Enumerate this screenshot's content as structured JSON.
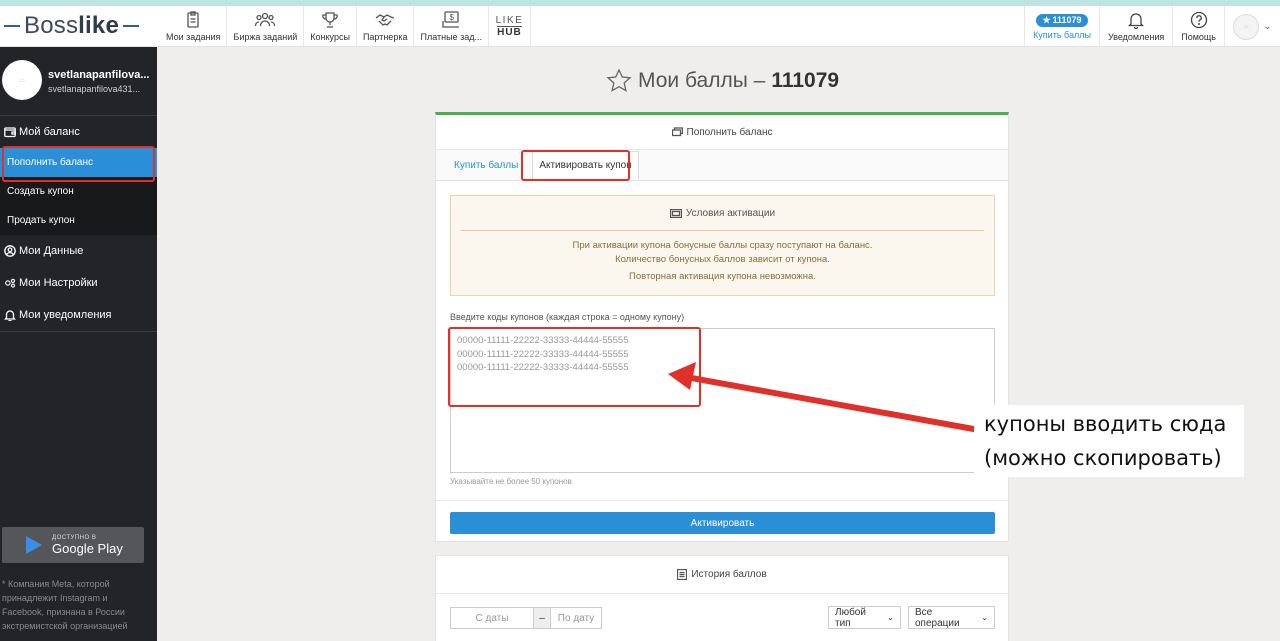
{
  "header": {
    "logo_prefix": "Boss",
    "logo_bold": "like",
    "nav": [
      {
        "label": "Мои задания",
        "icon": "clipboard-icon"
      },
      {
        "label": "Биржа заданий",
        "icon": "users-icon"
      },
      {
        "label": "Конкурсы",
        "icon": "trophy-icon"
      },
      {
        "label": "Партнерка",
        "icon": "handshake-icon"
      },
      {
        "label": "Платные зад...",
        "icon": "paid-tasks-icon"
      }
    ],
    "likehub_top": "LIKE",
    "likehub_bottom": "HUB",
    "points_badge": "111079",
    "buy_points_label": "Купить баллы",
    "notifications_label": "Уведомления",
    "help_label": "Помощь"
  },
  "sidebar": {
    "username": "svetlanapanfilova...",
    "email": "svetlanapanfilova431...",
    "balance_group": "Мой баланс",
    "balance_items": [
      "Пополнить баланс",
      "Создать купон",
      "Продать купон"
    ],
    "my_data": "Мои Данные",
    "my_settings": "Мои Настройки",
    "my_notifications": "Мои уведомления",
    "gplay_small": "ДОСТУПНО В",
    "gplay_big": "Google Play",
    "meta_note": "* Компания Meta, которой принадлежит Instagram и Facebook, признана в России экстремистской организацией"
  },
  "main": {
    "title_prefix": "Мои баллы –",
    "title_points": "111079",
    "card_title": "Пополнить баланс",
    "tab_buy": "Купить баллы",
    "tab_activate": "Активировать купон",
    "cond_title": "Условия активации",
    "cond_line1": "При активации купона бонусные баллы сразу поступают на баланс.",
    "cond_line2": "Количество бонусных баллов зависит от купона.",
    "cond_line3": "Повторная активация купона невозможна.",
    "codes_label": "Введите коды купонов (каждая строка = одному купону)",
    "codes_placeholder": "00000-11111-22222-33333-44444-55555\n00000-11111-22222-33333-44444-55555\n00000-11111-22222-33333-44444-55555",
    "codes_help": "Указывайте не более 50 купонов",
    "activate_button": "Активировать",
    "history_title": "История баллов",
    "date_from": "С даты",
    "date_sep": "–",
    "date_to": "По дату",
    "type_select": "Любой тип",
    "ops_select": "Все операции"
  },
  "annotation": {
    "line1": "купоны вводить сюда",
    "line2": "(можно скопировать)",
    "color": "#e0302a"
  }
}
